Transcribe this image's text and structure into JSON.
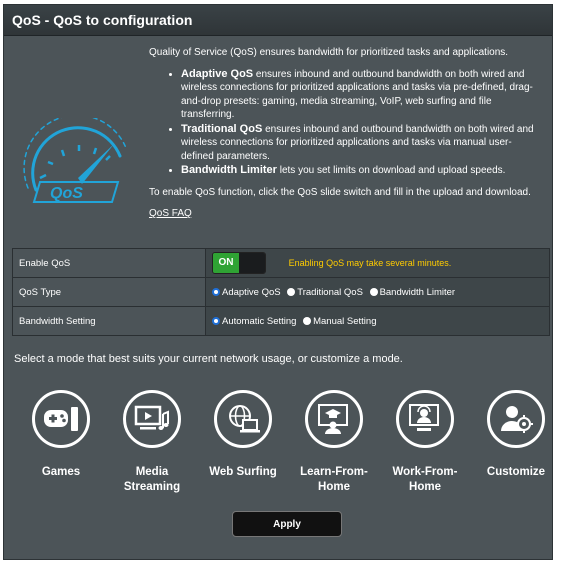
{
  "header": {
    "title": "QoS - QoS to configuration"
  },
  "intro": {
    "lead": "Quality of Service (QoS) ensures bandwidth for prioritized tasks and applications.",
    "bullets": [
      {
        "name": "Adaptive QoS",
        "text": " ensures inbound and outbound bandwidth on both wired and wireless connections for prioritized applications and tasks via pre-defined, drag-and-drop presets: gaming, media streaming, VoIP, web surfing and file transferring."
      },
      {
        "name": "Traditional QoS",
        "text": " ensures inbound and outbound bandwidth on both wired and wireless connections for prioritized applications and tasks via manual user-defined parameters."
      },
      {
        "name": "Bandwidth Limiter",
        "text": " lets you set limits on download and upload speeds."
      }
    ],
    "enable_note": "To enable QoS function, click the QoS slide switch and fill in the upload and download.",
    "faq_link": "QoS FAQ"
  },
  "settings": {
    "enable_qos": {
      "label": "Enable QoS",
      "toggle": "ON",
      "note": "Enabling QoS may take several minutes."
    },
    "qos_type": {
      "label": "QoS Type",
      "options": [
        "Adaptive QoS",
        "Traditional QoS",
        "Bandwidth Limiter"
      ],
      "selected": "Adaptive QoS"
    },
    "bandwidth": {
      "label": "Bandwidth Setting",
      "options": [
        "Automatic Setting",
        "Manual Setting"
      ],
      "selected": "Automatic Setting"
    }
  },
  "mode_prompt": "Select a mode that best suits your current network usage, or customize a mode.",
  "modes": [
    {
      "line1": "Games",
      "line2": "",
      "icon": "gamepad-icon"
    },
    {
      "line1": "Media",
      "line2": "Streaming",
      "icon": "media-streaming-icon"
    },
    {
      "line1": "Web Surfing",
      "line2": "",
      "icon": "web-surfing-icon"
    },
    {
      "line1": "Learn-From-",
      "line2": "Home",
      "icon": "learn-from-home-icon"
    },
    {
      "line1": "Work-From-",
      "line2": "Home",
      "icon": "work-from-home-icon"
    },
    {
      "line1": "Customize",
      "line2": "",
      "icon": "customize-icon"
    }
  ],
  "apply_label": "Apply",
  "colors": {
    "panel": "#4c5458",
    "accent_on": "#2fa334",
    "warning": "#ffcc00",
    "logo": "#21a4d8"
  }
}
